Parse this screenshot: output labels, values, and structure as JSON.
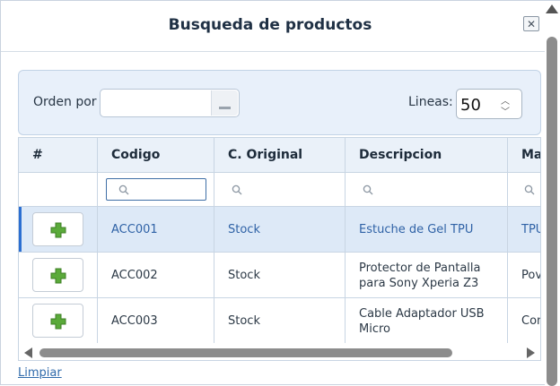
{
  "dialog": {
    "title": "Busqueda de productos",
    "close_label": "✕"
  },
  "toolbar": {
    "orden_label": "Orden por",
    "orden_value": "",
    "lineas_label": "Lineas:",
    "lineas_value": "50"
  },
  "grid": {
    "columns": [
      "#",
      "Codigo",
      "C. Original",
      "Descripcion",
      "Ma"
    ],
    "filter_icon": "search-icon",
    "rows": [
      {
        "codigo": "ACC001",
        "original": "Stock",
        "descripcion": [
          "Estuche de Gel TPU"
        ],
        "marca": "TPU",
        "selected": true
      },
      {
        "codigo": "ACC002",
        "original": "Stock",
        "descripcion": [
          "Protector de Pantalla",
          "para Sony Xperia Z3"
        ],
        "marca": "Pov",
        "selected": false
      },
      {
        "codigo": "ACC003",
        "original": "Stock",
        "descripcion": [
          "Cable Adaptador USB",
          "Micro"
        ],
        "marca": "Con",
        "selected": false
      }
    ]
  },
  "footer": {
    "limpiar_label": "Limpiar"
  },
  "colors": {
    "accent": "#2c6fd1",
    "plus_icon": "#5aaa3a",
    "link": "#2f6aab"
  }
}
